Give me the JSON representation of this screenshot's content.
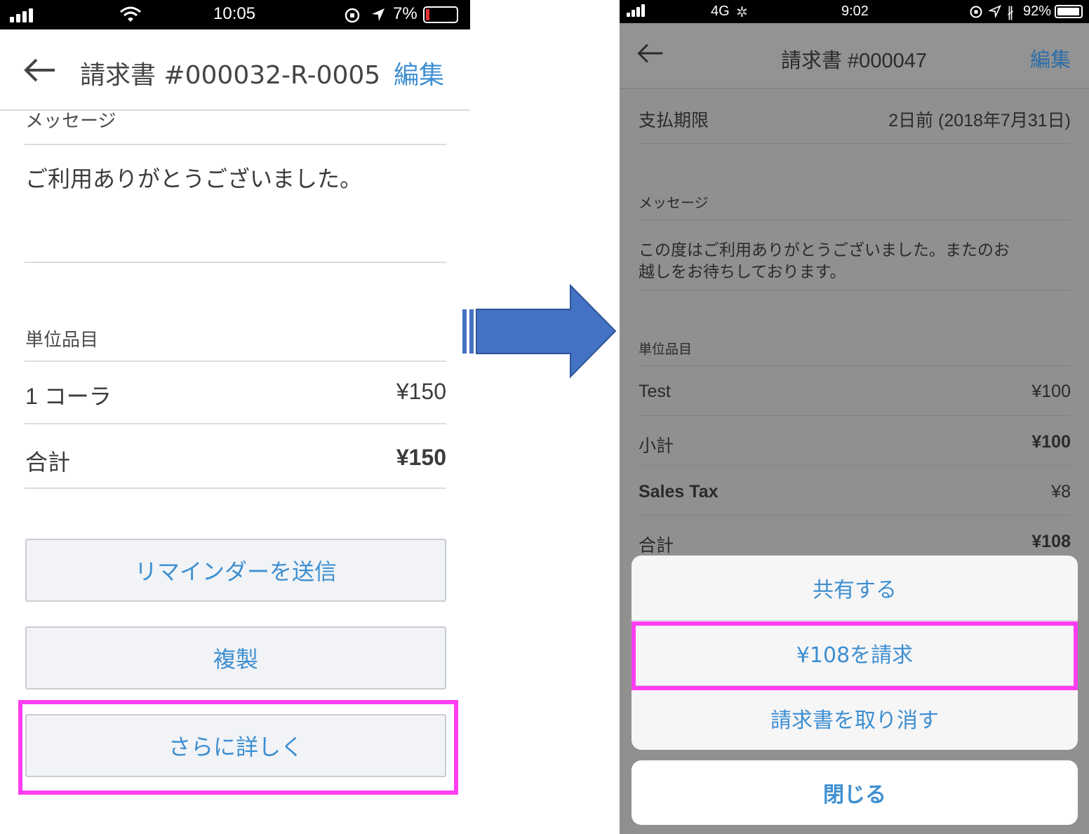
{
  "left": {
    "status": {
      "time": "10:05",
      "battery": "7%"
    },
    "nav": {
      "title": "請求書 #000032-R-0005",
      "edit": "編集"
    },
    "message_label": "メッセージ",
    "message_text": "ご利用ありがとうございました。",
    "items_label": "単位品目",
    "item": {
      "name": "1 コーラ",
      "price": "¥150"
    },
    "total": {
      "label": "合計",
      "value": "¥150"
    },
    "buttons": {
      "reminder": "リマインダーを送信",
      "duplicate": "複製",
      "more": "さらに詳しく"
    }
  },
  "right": {
    "status": {
      "network": "4G",
      "time": "9:02",
      "battery": "92%"
    },
    "nav": {
      "title": "請求書 #000047",
      "edit": "編集"
    },
    "due": {
      "label": "支払期限",
      "value": "2日前 (2018年7月31日)"
    },
    "message_label": "メッセージ",
    "message_text_line1": "この度はご利用ありがとうございました。またのお",
    "message_text_line2": "越しをお待ちしております。",
    "items_label": "単位品目",
    "item": {
      "name": "Test",
      "price": "¥100"
    },
    "subtotal": {
      "label": "小計",
      "value": "¥100"
    },
    "tax": {
      "label": "Sales Tax",
      "value": "¥8"
    },
    "total": {
      "label": "合計",
      "value": "¥108"
    },
    "sheet": {
      "share": "共有する",
      "charge": "¥108を請求",
      "cancel": "請求書を取り消す",
      "close": "閉じる"
    }
  },
  "colors": {
    "accent": "#3e8fd1",
    "highlight": "#ff3df2",
    "arrow": "#4472c4"
  },
  "icons": [
    "signal-icon",
    "wifi-icon",
    "orientation-lock-icon",
    "location-icon",
    "battery-icon",
    "bluetooth-icon",
    "back-arrow-icon"
  ]
}
